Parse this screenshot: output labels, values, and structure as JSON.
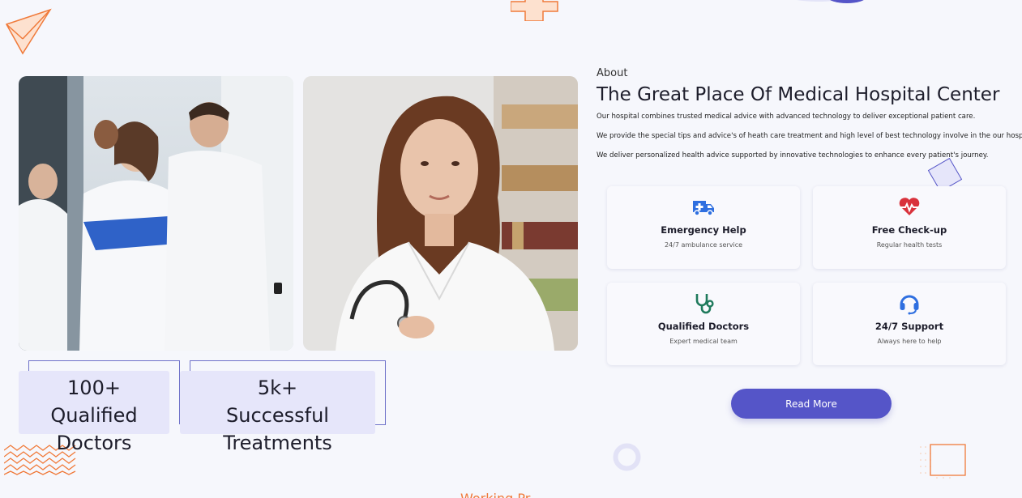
{
  "about": {
    "label": "About",
    "title": "The Great Place Of Medical Hospital Center",
    "paragraphs": [
      "Our hospital combines trusted medical advice with advanced technology to deliver exceptional patient care.",
      "We provide the special tips and advice's of heath care treatment and high level of best technology involve in the our hospital.",
      "We deliver personalized health advice supported by innovative technologies to enhance every patient's journey."
    ]
  },
  "stats": [
    {
      "value": "100+",
      "label": "Qualified Doctors"
    },
    {
      "value": "5k+",
      "label": "Successful Treatments"
    }
  ],
  "features": [
    {
      "icon": "ambulance-icon",
      "title": "Emergency Help",
      "subtitle": "24/7 ambulance service",
      "color": "#2f6fe0"
    },
    {
      "icon": "heart-pulse-icon",
      "title": "Free Check-up",
      "subtitle": "Regular health tests",
      "color": "#d9323c"
    },
    {
      "icon": "stethoscope-icon",
      "title": "Qualified Doctors",
      "subtitle": "Expert medical team",
      "color": "#1f7a5c"
    },
    {
      "icon": "headset-icon",
      "title": "24/7 Support",
      "subtitle": "Always here to help",
      "color": "#2f6fe0"
    }
  ],
  "cta": {
    "label": "Read More"
  },
  "bottom": {
    "heading": "Working Pr"
  },
  "colors": {
    "accent": "#5555c8",
    "stat_bg": "#e6e6fa",
    "decor_orange": "#f07a3a",
    "page_bg": "#f6f7fc"
  }
}
